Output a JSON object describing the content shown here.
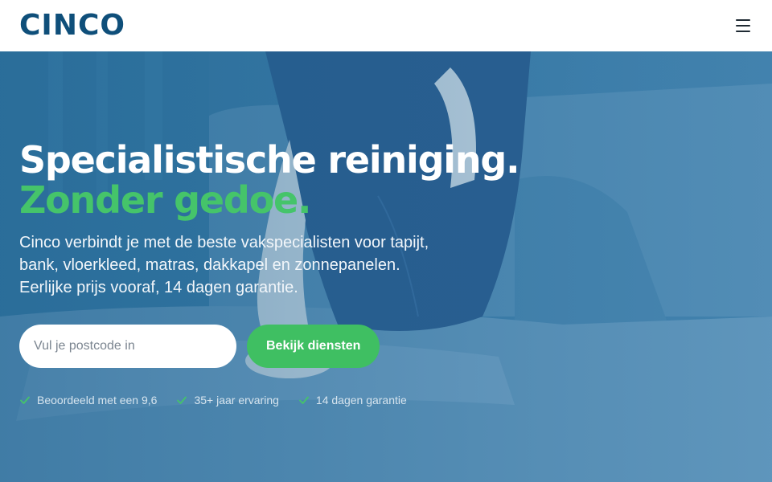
{
  "brand": {
    "name": "CINCO",
    "color": "#0f4f7a"
  },
  "header": {
    "menu_icon": "hamburger-menu-icon"
  },
  "hero": {
    "title_line1": "Specialistische reiniging.",
    "title_line2": "Zonder gedoe.",
    "accent_color": "#45c46a",
    "intro_lines": [
      "Cinco verbindt je met de beste vakspecialisten voor tapijt,",
      "bank, vloerkleed, matras, dakkapel en zonnepanelen.",
      "Eerlijke prijs vooraf, 14 dagen garantie."
    ],
    "background_image": "person cleaning a sofa with blue overlay"
  },
  "search": {
    "placeholder": "Vul je postcode in",
    "value": "",
    "button_label": "Bekijk diensten",
    "button_color": "#3fbf62"
  },
  "usps": [
    {
      "label": "Beoordeeld met een 9,6",
      "icon": "check-icon"
    },
    {
      "label": "35+ jaar ervaring",
      "icon": "check-icon"
    },
    {
      "label": "14 dagen garantie",
      "icon": "check-icon"
    }
  ]
}
